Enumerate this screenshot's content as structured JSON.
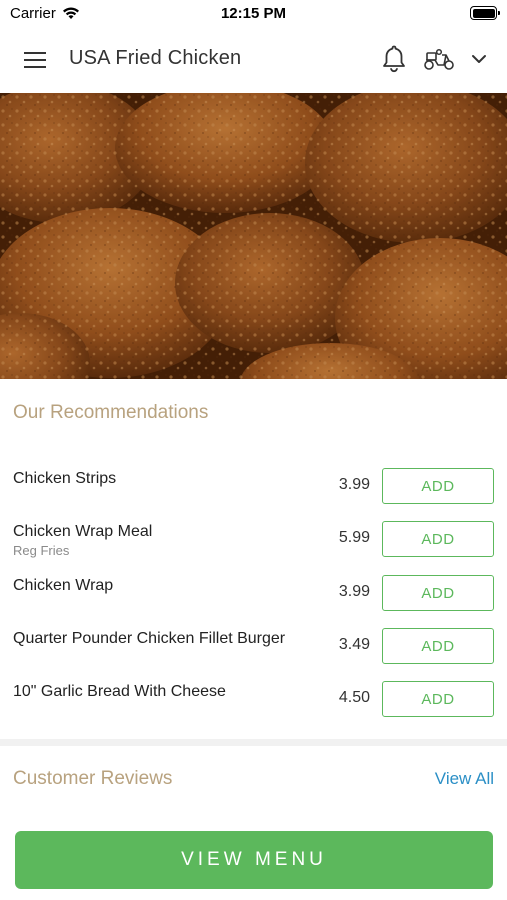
{
  "status_bar": {
    "carrier": "Carrier",
    "time": "12:15 PM"
  },
  "header": {
    "title": "USA Fried Chicken",
    "icons": [
      "menu-icon",
      "bell-icon",
      "scooter-icon",
      "chevron-down-icon"
    ]
  },
  "hero": {
    "icon": "fried-chicken-photo"
  },
  "recommendations": {
    "title": "Our Recommendations",
    "add_label": "ADD",
    "items": [
      {
        "name": "Chicken Strips",
        "sub": "",
        "price": "3.99"
      },
      {
        "name": "Chicken Wrap Meal",
        "sub": "Reg Fries",
        "price": "5.99"
      },
      {
        "name": "Chicken Wrap",
        "sub": "",
        "price": "3.99"
      },
      {
        "name": "Quarter Pounder Chicken Fillet Burger",
        "sub": "",
        "price": "3.49"
      },
      {
        "name": "10\" Garlic Bread With Cheese",
        "sub": "",
        "price": "4.50"
      }
    ]
  },
  "reviews": {
    "title": "Customer Reviews",
    "view_all": "View All"
  },
  "footer": {
    "view_menu": "VIEW MENU"
  },
  "colors": {
    "accent_green": "#5cb85c",
    "section_title": "#b8a27f",
    "link_blue": "#2b8fc6"
  }
}
